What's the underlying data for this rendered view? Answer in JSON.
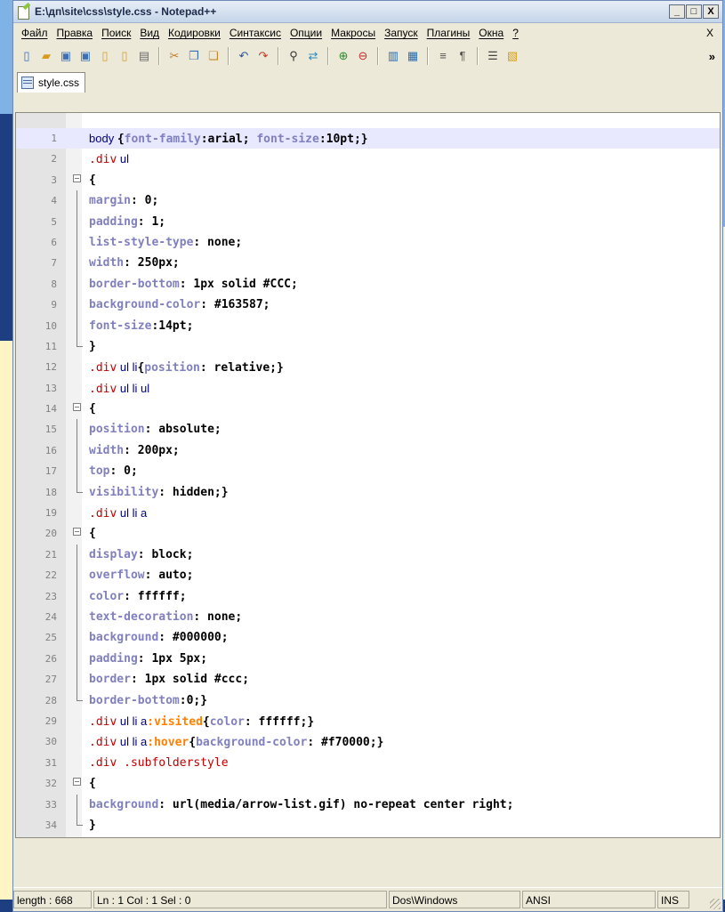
{
  "window": {
    "title": "E:\\дп\\site\\css\\style.css - Notepad++",
    "minimize": "_",
    "maximize": "□",
    "close": "X"
  },
  "menu": {
    "items": [
      "Файл",
      "Правка",
      "Поиск",
      "Вид",
      "Кодировки",
      "Синтаксис",
      "Опции",
      "Макросы",
      "Запуск",
      "Плагины",
      "Окна",
      "?"
    ],
    "close": "X"
  },
  "toolbar": {
    "buttons": [
      {
        "name": "new-file-icon",
        "glyph": "▯",
        "color": "#2f6fc9"
      },
      {
        "name": "open-file-icon",
        "glyph": "▰",
        "color": "#d89b1d"
      },
      {
        "name": "save-icon",
        "glyph": "▣",
        "color": "#3b6fb6"
      },
      {
        "name": "save-all-icon",
        "glyph": "▣",
        "color": "#3b6fb6"
      },
      {
        "name": "close-file-icon",
        "glyph": "▯",
        "color": "#d8a020"
      },
      {
        "name": "close-all-icon",
        "glyph": "▯",
        "color": "#d8a020"
      },
      {
        "name": "print-icon",
        "glyph": "▤",
        "color": "#6b6b6b"
      },
      {
        "name": "cut-icon",
        "glyph": "✂",
        "color": "#c07a2a"
      },
      {
        "name": "copy-icon",
        "glyph": "❐",
        "color": "#3b6fb6"
      },
      {
        "name": "paste-icon",
        "glyph": "❏",
        "color": "#c08a2a"
      },
      {
        "name": "undo-icon",
        "glyph": "↶",
        "color": "#2a54a0"
      },
      {
        "name": "redo-icon",
        "glyph": "↷",
        "color": "#c03a2a"
      },
      {
        "name": "find-icon",
        "glyph": "⚲",
        "color": "#333333"
      },
      {
        "name": "replace-icon",
        "glyph": "⇄",
        "color": "#2a8ac0"
      },
      {
        "name": "zoom-in-icon",
        "glyph": "⊕",
        "color": "#2a8a2a"
      },
      {
        "name": "zoom-out-icon",
        "glyph": "⊖",
        "color": "#c02a2a"
      },
      {
        "name": "sync-vertical-icon",
        "glyph": "▥",
        "color": "#2a6ab0"
      },
      {
        "name": "sync-horizontal-icon",
        "glyph": "▦",
        "color": "#2a6ab0"
      },
      {
        "name": "word-wrap-icon",
        "glyph": "≡",
        "color": "#555555"
      },
      {
        "name": "show-all-chars-icon",
        "glyph": "¶",
        "color": "#555555"
      },
      {
        "name": "indent-guide-icon",
        "glyph": "☰",
        "color": "#444444"
      },
      {
        "name": "user-language-icon",
        "glyph": "▧",
        "color": "#d8a020"
      }
    ],
    "overflow": "»"
  },
  "tab": {
    "label": "style.css"
  },
  "editor": {
    "lines": [
      {
        "n": "1",
        "fold": "",
        "code": [
          {
            "t": "body ",
            "c": "sel"
          },
          {
            "t": "{",
            "c": "brace"
          },
          {
            "t": "font-family",
            "c": "prop"
          },
          {
            "t": ":arial; ",
            "c": "val"
          },
          {
            "t": "font-size",
            "c": "prop"
          },
          {
            "t": ":10pt;}",
            "c": "val"
          }
        ]
      },
      {
        "n": "2",
        "fold": "",
        "code": [
          {
            "t": ".div",
            "c": "cls"
          },
          {
            "t": " ul",
            "c": "sel"
          }
        ]
      },
      {
        "n": "3",
        "fold": "box",
        "code": [
          {
            "t": "{",
            "c": "brace"
          }
        ]
      },
      {
        "n": "4",
        "fold": "line",
        "code": [
          {
            "t": "margin",
            "c": "prop"
          },
          {
            "t": ": 0;",
            "c": "val"
          }
        ]
      },
      {
        "n": "5",
        "fold": "line",
        "code": [
          {
            "t": "padding",
            "c": "prop"
          },
          {
            "t": ": 1;",
            "c": "val"
          }
        ]
      },
      {
        "n": "6",
        "fold": "line",
        "code": [
          {
            "t": "list-style-type",
            "c": "prop"
          },
          {
            "t": ": none;",
            "c": "val"
          }
        ]
      },
      {
        "n": "7",
        "fold": "line",
        "code": [
          {
            "t": "width",
            "c": "prop"
          },
          {
            "t": ": 250px;",
            "c": "val"
          }
        ]
      },
      {
        "n": "8",
        "fold": "line",
        "code": [
          {
            "t": "border-bottom",
            "c": "prop"
          },
          {
            "t": ": 1px solid #CCC;",
            "c": "val"
          }
        ]
      },
      {
        "n": "9",
        "fold": "line",
        "code": [
          {
            "t": "background-color",
            "c": "prop"
          },
          {
            "t": ": #163587;",
            "c": "val"
          }
        ]
      },
      {
        "n": "10",
        "fold": "line",
        "code": [
          {
            "t": "font-size",
            "c": "prop"
          },
          {
            "t": ":14pt;",
            "c": "val"
          }
        ]
      },
      {
        "n": "11",
        "fold": "end",
        "code": [
          {
            "t": "}",
            "c": "brace"
          }
        ]
      },
      {
        "n": "12",
        "fold": "",
        "code": [
          {
            "t": ".div",
            "c": "cls"
          },
          {
            "t": " ul li",
            "c": "sel"
          },
          {
            "t": "{",
            "c": "brace"
          },
          {
            "t": "position",
            "c": "prop"
          },
          {
            "t": ": relative;}",
            "c": "val"
          }
        ]
      },
      {
        "n": "13",
        "fold": "",
        "code": [
          {
            "t": ".div",
            "c": "cls"
          },
          {
            "t": " ul li ul",
            "c": "sel"
          }
        ]
      },
      {
        "n": "14",
        "fold": "box",
        "code": [
          {
            "t": "{",
            "c": "brace"
          }
        ]
      },
      {
        "n": "15",
        "fold": "line",
        "code": [
          {
            "t": "position",
            "c": "prop"
          },
          {
            "t": ": absolute;",
            "c": "val"
          }
        ]
      },
      {
        "n": "16",
        "fold": "line",
        "code": [
          {
            "t": "width",
            "c": "prop"
          },
          {
            "t": ": 200px;",
            "c": "val"
          }
        ]
      },
      {
        "n": "17",
        "fold": "line",
        "code": [
          {
            "t": "top",
            "c": "prop"
          },
          {
            "t": ": 0;",
            "c": "val"
          }
        ]
      },
      {
        "n": "18",
        "fold": "end",
        "code": [
          {
            "t": "visibility",
            "c": "prop"
          },
          {
            "t": ": hidden;}",
            "c": "val"
          }
        ]
      },
      {
        "n": "19",
        "fold": "",
        "code": [
          {
            "t": ".div",
            "c": "cls"
          },
          {
            "t": " ul li a",
            "c": "sel"
          }
        ]
      },
      {
        "n": "20",
        "fold": "box",
        "code": [
          {
            "t": "{",
            "c": "brace"
          }
        ]
      },
      {
        "n": "21",
        "fold": "line",
        "code": [
          {
            "t": "display",
            "c": "prop"
          },
          {
            "t": ": block;",
            "c": "val"
          }
        ]
      },
      {
        "n": "22",
        "fold": "line",
        "code": [
          {
            "t": "overflow",
            "c": "prop"
          },
          {
            "t": ": auto;",
            "c": "val"
          }
        ]
      },
      {
        "n": "23",
        "fold": "line",
        "code": [
          {
            "t": "color",
            "c": "prop"
          },
          {
            "t": ": ffffff;",
            "c": "val"
          }
        ]
      },
      {
        "n": "24",
        "fold": "line",
        "code": [
          {
            "t": "text-decoration",
            "c": "prop"
          },
          {
            "t": ": none;",
            "c": "val"
          }
        ]
      },
      {
        "n": "25",
        "fold": "line",
        "code": [
          {
            "t": "background",
            "c": "prop"
          },
          {
            "t": ": #000000;",
            "c": "val"
          }
        ]
      },
      {
        "n": "26",
        "fold": "line",
        "code": [
          {
            "t": "padding",
            "c": "prop"
          },
          {
            "t": ": 1px 5px;",
            "c": "val"
          }
        ]
      },
      {
        "n": "27",
        "fold": "line",
        "code": [
          {
            "t": "border",
            "c": "prop"
          },
          {
            "t": ": 1px solid #ccc;",
            "c": "val"
          }
        ]
      },
      {
        "n": "28",
        "fold": "end",
        "code": [
          {
            "t": "border-bottom",
            "c": "prop"
          },
          {
            "t": ":0;}",
            "c": "val"
          }
        ]
      },
      {
        "n": "29",
        "fold": "",
        "code": [
          {
            "t": ".div",
            "c": "cls"
          },
          {
            "t": " ul li a",
            "c": "sel"
          },
          {
            "t": ":visited",
            "c": "pseudo"
          },
          {
            "t": "{",
            "c": "brace"
          },
          {
            "t": "color",
            "c": "prop"
          },
          {
            "t": ": ffffff;}",
            "c": "val"
          }
        ]
      },
      {
        "n": "30",
        "fold": "",
        "code": [
          {
            "t": ".div",
            "c": "cls"
          },
          {
            "t": " ul li a",
            "c": "sel"
          },
          {
            "t": ":hover",
            "c": "pseudo"
          },
          {
            "t": "{",
            "c": "brace"
          },
          {
            "t": "background-color",
            "c": "prop"
          },
          {
            "t": ": #f70000;}",
            "c": "val"
          }
        ]
      },
      {
        "n": "31",
        "fold": "",
        "code": [
          {
            "t": ".div",
            "c": "cls"
          },
          {
            "t": " .subfolderstyle",
            "c": "cls"
          }
        ]
      },
      {
        "n": "32",
        "fold": "box",
        "code": [
          {
            "t": "{",
            "c": "brace"
          }
        ]
      },
      {
        "n": "33",
        "fold": "line",
        "code": [
          {
            "t": "background",
            "c": "prop"
          },
          {
            "t": ": url(media/arrow-list.gif) no-repeat center right;",
            "c": "val"
          }
        ]
      },
      {
        "n": "34",
        "fold": "end",
        "code": [
          {
            "t": "}",
            "c": "brace"
          }
        ]
      }
    ],
    "current_line": 1
  },
  "status": {
    "length": "length : 668",
    "position": "Ln : 1   Col : 1   Sel : 0",
    "eol": "Dos\\Windows",
    "encoding": "ANSI",
    "mode": "INS"
  }
}
